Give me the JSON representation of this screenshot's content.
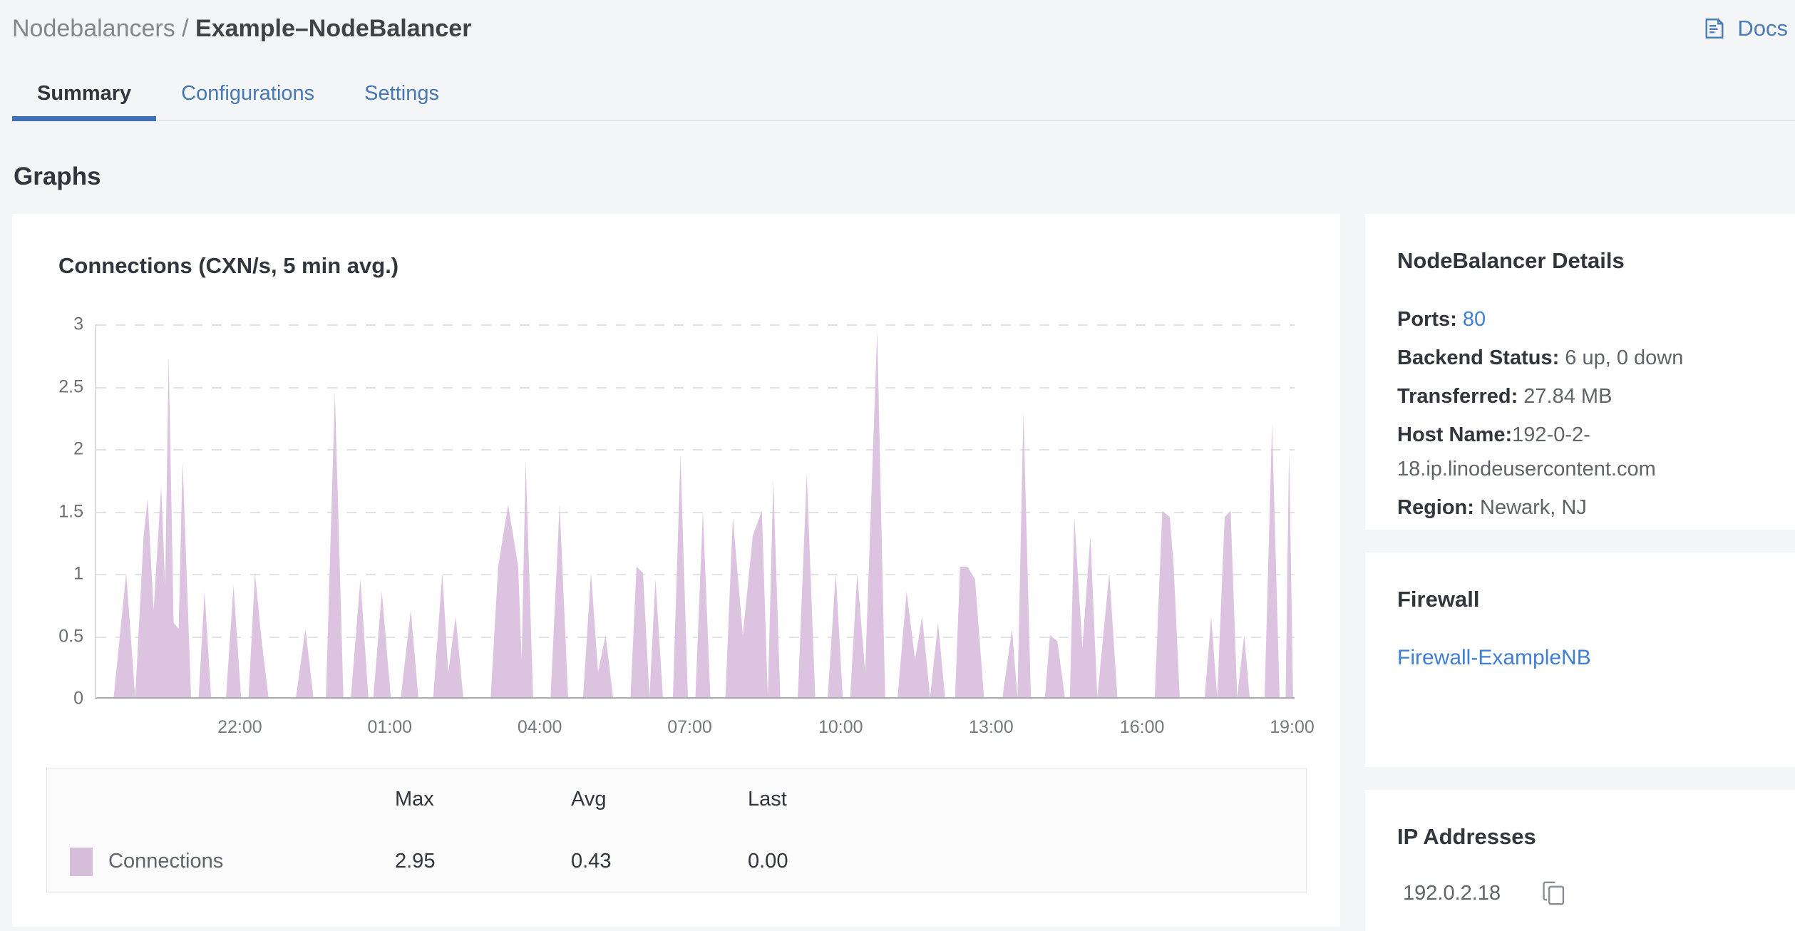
{
  "header": {
    "breadcrumb": {
      "section": "Nodebalancers",
      "separator": " / ",
      "current": "Example–NodeBalancer"
    },
    "docs": {
      "label": "Docs",
      "icon": "docs-icon"
    }
  },
  "tabs": [
    {
      "label": "Summary",
      "active": true
    },
    {
      "label": "Configurations",
      "active": false
    },
    {
      "label": "Settings",
      "active": false
    }
  ],
  "section_title": "Graphs",
  "chart_data": {
    "type": "area",
    "title": "Connections (CXN/s, 5 min avg.)",
    "xlabel": "",
    "ylabel": "",
    "ylim": [
      0,
      3
    ],
    "x_hours_span": 24,
    "grid": "dashed-horizontal",
    "legend_position": "bottom-table",
    "yticks": [
      0,
      0.5,
      1,
      1.5,
      2,
      2.5,
      3
    ],
    "ytick_labels": [
      "0",
      "0.5",
      "1",
      "1.5",
      "2",
      "2.5",
      "3"
    ],
    "xticks": [
      {
        "t": 2.9,
        "label": "22:00"
      },
      {
        "t": 5.9,
        "label": "01:00"
      },
      {
        "t": 8.9,
        "label": "04:00"
      },
      {
        "t": 11.9,
        "label": "07:00"
      },
      {
        "t": 14.92,
        "label": "10:00"
      },
      {
        "t": 17.93,
        "label": "13:00"
      },
      {
        "t": 20.95,
        "label": "16:00"
      },
      {
        "t": 23.95,
        "label": "19:00"
      }
    ],
    "series": [
      {
        "name": "Connections",
        "color": "#dcc3df",
        "swatch_color": "#d6bdda",
        "max": 2.95,
        "avg": 0.43,
        "last": 0.0,
        "points": [
          [
            0,
            0
          ],
          [
            0.35,
            0
          ],
          [
            0.6,
            1.0
          ],
          [
            0.78,
            0
          ],
          [
            0.95,
            1.3
          ],
          [
            1.03,
            1.6
          ],
          [
            1.15,
            0.7
          ],
          [
            1.3,
            1.7
          ],
          [
            1.38,
            0.9
          ],
          [
            1.45,
            2.75
          ],
          [
            1.55,
            0.6
          ],
          [
            1.65,
            0.55
          ],
          [
            1.73,
            1.9
          ],
          [
            1.9,
            0
          ],
          [
            2.05,
            0
          ],
          [
            2.17,
            0.85
          ],
          [
            2.3,
            0
          ],
          [
            2.6,
            0
          ],
          [
            2.75,
            0.9
          ],
          [
            2.9,
            0
          ],
          [
            3.05,
            0
          ],
          [
            3.18,
            1.0
          ],
          [
            3.3,
            0.5
          ],
          [
            3.45,
            0
          ],
          [
            4.0,
            0
          ],
          [
            4.19,
            0.55
          ],
          [
            4.35,
            0
          ],
          [
            4.6,
            0
          ],
          [
            4.78,
            2.45
          ],
          [
            4.95,
            0
          ],
          [
            5.1,
            0
          ],
          [
            5.29,
            0.95
          ],
          [
            5.45,
            0
          ],
          [
            5.55,
            0
          ],
          [
            5.72,
            0.85
          ],
          [
            5.9,
            0
          ],
          [
            6.1,
            0
          ],
          [
            6.3,
            0.7
          ],
          [
            6.45,
            0
          ],
          [
            6.75,
            0
          ],
          [
            6.93,
            1.0
          ],
          [
            7.05,
            0.2
          ],
          [
            7.2,
            0.65
          ],
          [
            7.35,
            0
          ],
          [
            7.9,
            0
          ],
          [
            8.05,
            1.05
          ],
          [
            8.25,
            1.55
          ],
          [
            8.45,
            1.05
          ],
          [
            8.52,
            0.3
          ],
          [
            8.6,
            1.9
          ],
          [
            8.75,
            0
          ],
          [
            9.1,
            0
          ],
          [
            9.28,
            1.55
          ],
          [
            9.45,
            0
          ],
          [
            9.75,
            0
          ],
          [
            9.91,
            1.0
          ],
          [
            10.05,
            0.2
          ],
          [
            10.2,
            0.5
          ],
          [
            10.35,
            0
          ],
          [
            10.7,
            0
          ],
          [
            10.82,
            1.05
          ],
          [
            10.95,
            1.0
          ],
          [
            11.08,
            0
          ],
          [
            11.2,
            0.95
          ],
          [
            11.35,
            0
          ],
          [
            11.55,
            0
          ],
          [
            11.7,
            1.95
          ],
          [
            11.85,
            0
          ],
          [
            12.0,
            0
          ],
          [
            12.15,
            1.5
          ],
          [
            12.3,
            0
          ],
          [
            12.6,
            0
          ],
          [
            12.75,
            1.45
          ],
          [
            12.95,
            0.5
          ],
          [
            13.15,
            1.3
          ],
          [
            13.33,
            1.5
          ],
          [
            13.45,
            0
          ],
          [
            13.56,
            1.75
          ],
          [
            13.7,
            0
          ],
          [
            14.05,
            0
          ],
          [
            14.23,
            1.8
          ],
          [
            14.4,
            0
          ],
          [
            14.65,
            0
          ],
          [
            14.81,
            1.0
          ],
          [
            14.95,
            0
          ],
          [
            15.1,
            0
          ],
          [
            15.24,
            1.0
          ],
          [
            15.4,
            0.2
          ],
          [
            15.64,
            2.95
          ],
          [
            15.8,
            0
          ],
          [
            16.05,
            0
          ],
          [
            16.23,
            0.85
          ],
          [
            16.4,
            0.3
          ],
          [
            16.54,
            0.65
          ],
          [
            16.7,
            0
          ],
          [
            16.86,
            0.6
          ],
          [
            17.0,
            0
          ],
          [
            17.2,
            0
          ],
          [
            17.3,
            1.05
          ],
          [
            17.45,
            1.05
          ],
          [
            17.6,
            0.95
          ],
          [
            17.78,
            0
          ],
          [
            18.15,
            0
          ],
          [
            18.34,
            0.55
          ],
          [
            18.45,
            0
          ],
          [
            18.57,
            2.3
          ],
          [
            18.72,
            0
          ],
          [
            19.0,
            0
          ],
          [
            19.1,
            0.5
          ],
          [
            19.25,
            0.45
          ],
          [
            19.4,
            0
          ],
          [
            19.5,
            0
          ],
          [
            19.59,
            1.45
          ],
          [
            19.75,
            0.4
          ],
          [
            19.91,
            1.3
          ],
          [
            20.05,
            0
          ],
          [
            20.29,
            1.0
          ],
          [
            20.45,
            0
          ],
          [
            21.2,
            0
          ],
          [
            21.35,
            1.5
          ],
          [
            21.5,
            1.45
          ],
          [
            21.58,
            1.05
          ],
          [
            21.7,
            0
          ],
          [
            22.2,
            0
          ],
          [
            22.33,
            0.65
          ],
          [
            22.45,
            0
          ],
          [
            22.6,
            1.45
          ],
          [
            22.72,
            1.5
          ],
          [
            22.85,
            0
          ],
          [
            22.99,
            0.5
          ],
          [
            23.1,
            0
          ],
          [
            23.4,
            0
          ],
          [
            23.55,
            2.2
          ],
          [
            23.7,
            0
          ],
          [
            23.82,
            0
          ],
          [
            23.89,
            2.0
          ],
          [
            23.97,
            0
          ],
          [
            24,
            0
          ]
        ]
      }
    ]
  },
  "legend_table": {
    "headers": {
      "max": "Max",
      "avg": "Avg",
      "last": "Last"
    },
    "row": {
      "name": "Connections",
      "max": "2.95",
      "avg": "0.43",
      "last": "0.00",
      "swatch": "#d6bdda"
    }
  },
  "sidebar": {
    "details": {
      "title": "NodeBalancer Details",
      "ports_label": "Ports: ",
      "ports_value": "80",
      "backend_label": "Backend Status: ",
      "backend_value": "6 up, 0 down",
      "transferred_label": "Transferred: ",
      "transferred_value": "27.84 MB",
      "hostname_label": "Host Name:",
      "hostname_value": "192-0-2-18.ip.linodeusercontent.com",
      "region_label": "Region: ",
      "region_value": "Newark, NJ"
    },
    "firewall": {
      "title": "Firewall",
      "link": "Firewall-ExampleNB"
    },
    "ip": {
      "title": "IP Addresses",
      "address": "192.0.2.18",
      "copy_icon": "copy-icon"
    }
  },
  "colors": {
    "accent_blue": "#3d6fb8",
    "link_blue": "#3f7fd2",
    "tab_blue": "#4679b4",
    "area_fill": "#dcc3df",
    "page_bg": "#f4f5f6"
  }
}
